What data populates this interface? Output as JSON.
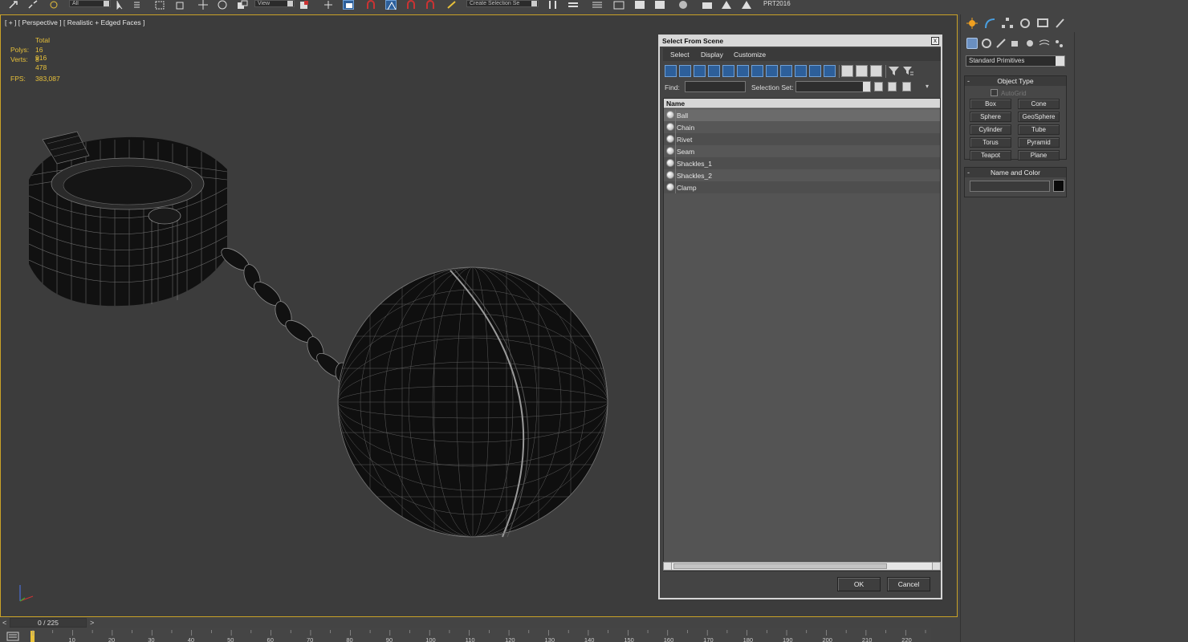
{
  "toolbar": {
    "dropdown_1": "All",
    "dropdown_2": "View",
    "dropdown_3": "Create Selection Se",
    "prt_label": "PRT2016"
  },
  "viewport": {
    "label": "[ + ] [ Perspective ] [ Realistic + Edged Faces ]",
    "stats": {
      "total_label": "Total",
      "polys_label": "Polys:",
      "polys_value": "16 916",
      "verts_label": "Verts:",
      "verts_value": "8 478",
      "fps_label": "FPS:",
      "fps_value": "383,087"
    }
  },
  "dialog": {
    "title": "Select From Scene",
    "close": "x",
    "menu": [
      "Select",
      "Display",
      "Customize"
    ],
    "find_label": "Find:",
    "find_value": "",
    "selection_set_label": "Selection Set:",
    "selection_set_value": "",
    "list_header": "Name",
    "items": [
      "Ball",
      "Chain",
      "Rivet",
      "Seam",
      "Shackles_1",
      "Shackles_2",
      "Clamp"
    ],
    "selected_item": "Ball",
    "ok_label": "OK",
    "cancel_label": "Cancel"
  },
  "command_panel": {
    "category": "Standard Primitives",
    "object_type_title": "Object Type",
    "autogrid_label": "AutoGrid",
    "primitives": [
      "Box",
      "Cone",
      "Sphere",
      "GeoSphere",
      "Cylinder",
      "Tube",
      "Torus",
      "Pyramid",
      "Teapot",
      "Plane"
    ],
    "name_color_title": "Name and Color",
    "name_value": "",
    "object_color": "#0a0a0a"
  },
  "timeline": {
    "frame_counter": "0 / 225",
    "ticks": [
      "10",
      "20",
      "30",
      "40",
      "50",
      "60",
      "70",
      "80",
      "90",
      "100",
      "110",
      "120",
      "130",
      "140",
      "150",
      "160",
      "170",
      "180",
      "190",
      "200",
      "210",
      "220"
    ]
  },
  "colors": {
    "viewport_border": "#c9a227",
    "stats_text": "#e8c13a",
    "selection_blue": "#2d5f9a"
  }
}
